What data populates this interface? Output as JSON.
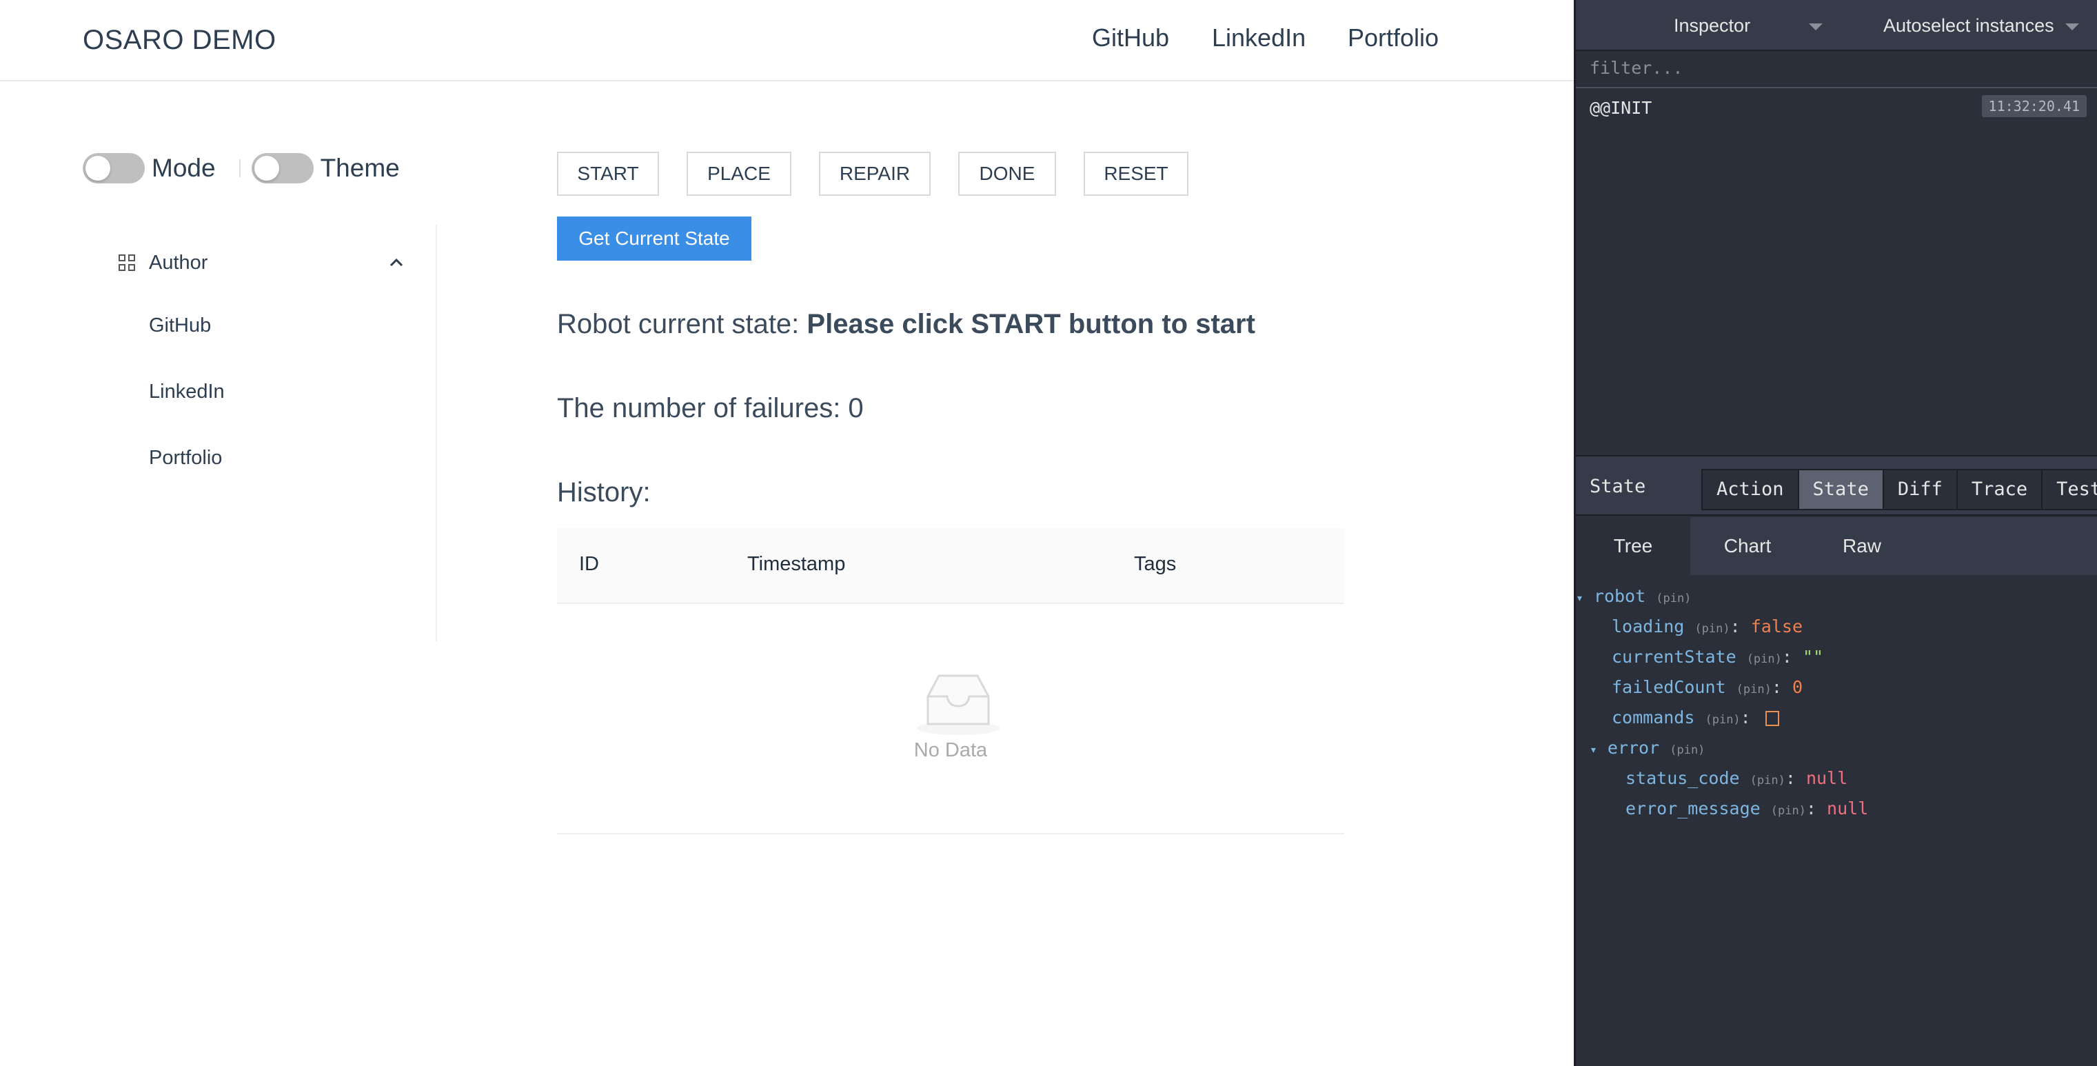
{
  "header": {
    "brand": "OSARO DEMO",
    "nav": [
      "GitHub",
      "LinkedIn",
      "Portfolio"
    ]
  },
  "toggles": {
    "mode_label": "Mode",
    "theme_label": "Theme",
    "mode_on": false,
    "theme_on": false
  },
  "sidebar": {
    "group_label": "Author",
    "items": [
      "GitHub",
      "LinkedIn",
      "Portfolio"
    ]
  },
  "controls": {
    "buttons": [
      "START",
      "PLACE",
      "REPAIR",
      "DONE",
      "RESET"
    ],
    "get_state_label": "Get Current State"
  },
  "status": {
    "state_prefix": "Robot current state:",
    "state_value": "Please click START button to start",
    "failures_text": "The number of failures: 0",
    "history_title": "History:"
  },
  "table": {
    "columns": [
      "ID",
      "Timestamp",
      "Tags"
    ],
    "empty_text": "No Data"
  },
  "devtools": {
    "inspector_label": "Inspector",
    "instances_label": "Autoselect instances",
    "filter_placeholder": "filter...",
    "actions": [
      {
        "name": "@@INIT",
        "time": "11:32:20.41"
      }
    ],
    "panel_title": "State",
    "tabs": [
      "Action",
      "State",
      "Diff",
      "Trace",
      "Test"
    ],
    "active_tab": "State",
    "subtabs": [
      "Tree",
      "Chart",
      "Raw"
    ],
    "active_subtab": "Tree",
    "tree": {
      "root_key": "robot",
      "pin": "(pin)",
      "loading_key": "loading",
      "loading_val": "false",
      "currentState_key": "currentState",
      "currentState_val": "\"\"",
      "failedCount_key": "failedCount",
      "failedCount_val": "0",
      "commands_key": "commands",
      "error_key": "error",
      "status_code_key": "status_code",
      "status_code_val": "null",
      "error_message_key": "error_message",
      "error_message_val": "null"
    }
  }
}
